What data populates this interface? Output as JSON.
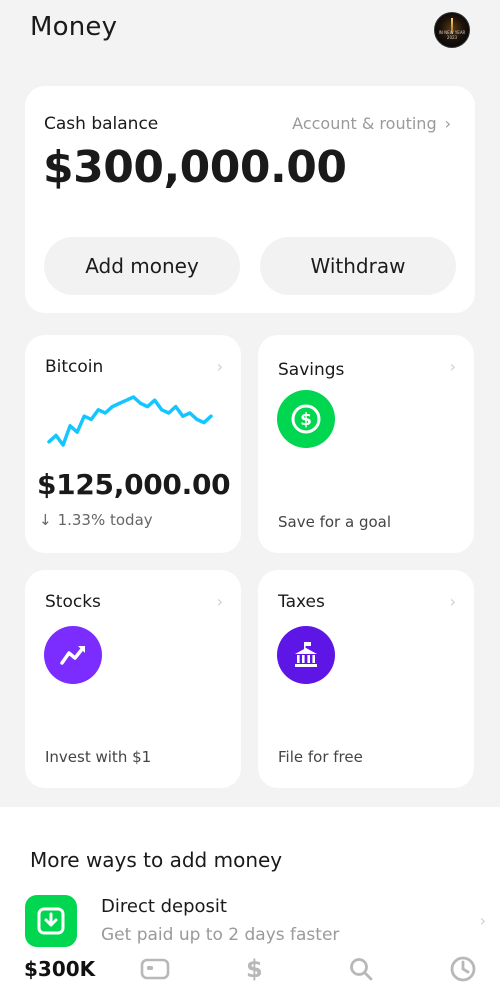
{
  "header": {
    "title": "Money",
    "avatar_text": "IN NEW YEAR 2023"
  },
  "balance": {
    "label": "Cash balance",
    "account_link": "Account & routing",
    "amount": "$300,000.00",
    "add_money": "Add money",
    "withdraw": "Withdraw"
  },
  "tiles": {
    "bitcoin": {
      "title": "Bitcoin",
      "value": "$125,000.00",
      "change": "1.33% today",
      "chart_points": [
        30,
        26,
        32,
        20,
        24,
        14,
        16,
        10,
        12,
        8,
        6,
        4,
        2,
        6,
        8,
        4,
        10,
        12,
        8,
        14,
        12,
        16,
        18,
        14
      ]
    },
    "savings": {
      "title": "Savings",
      "subtitle": "Save for a goal"
    },
    "stocks": {
      "title": "Stocks",
      "subtitle": "Invest with $1"
    },
    "taxes": {
      "title": "Taxes",
      "subtitle": "File for free"
    }
  },
  "more_ways": {
    "title": "More ways to add money",
    "direct_deposit": {
      "title": "Direct deposit",
      "subtitle": "Get paid up to 2 days faster"
    }
  },
  "tabbar": {
    "balance": "$300K",
    "pay_symbol": "$"
  },
  "icons": {
    "chevron": "chevron-right-icon",
    "savings": "dollar-circle-icon",
    "stocks": "trend-up-icon",
    "taxes": "bank-building-icon",
    "direct_deposit": "deposit-icon",
    "down_arrow": "arrow-down-icon"
  },
  "colors": {
    "cash_green": "#00d64f",
    "stocks_purple": "#7b2cff",
    "taxes_purple": "#5d16e6",
    "btc_line": "#14c6ff"
  }
}
